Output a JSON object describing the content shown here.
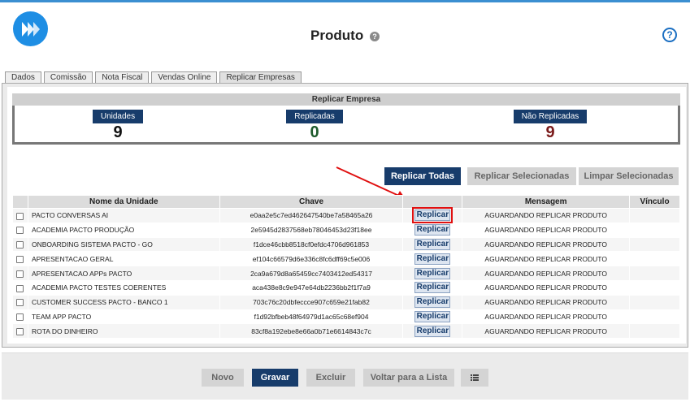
{
  "header": {
    "title": "Produto",
    "help_glyph": "?",
    "title_help_glyph": "?"
  },
  "tabs": [
    {
      "label": "Dados"
    },
    {
      "label": "Comissão"
    },
    {
      "label": "Nota Fiscal"
    },
    {
      "label": "Vendas Online"
    },
    {
      "label": "Replicar Empresas"
    }
  ],
  "replicar": {
    "section_title": "Replicar Empresa",
    "stats": [
      {
        "label": "Unidades",
        "value": "9",
        "color": "#111111"
      },
      {
        "label": "Replicadas",
        "value": "0",
        "color": "#1e5b2c"
      },
      {
        "label": "Não Replicadas",
        "value": "9",
        "color": "#7a1a1a"
      }
    ],
    "actions": {
      "replicar_todas": "Replicar Todas",
      "replicar_selecionadas": "Replicar Selecionadas",
      "limpar_selecionadas": "Limpar Selecionadas"
    },
    "table": {
      "headers": [
        "",
        "Nome da Unidade",
        "Chave",
        "",
        "Mensagem",
        "Vínculo"
      ],
      "rows": [
        {
          "nome": "PACTO CONVERSAS AI",
          "chave": "e0aa2e5c7ed462647540be7a58465a26",
          "acao": "Replicar",
          "mensagem": "AGUARDANDO REPLICAR PRODUTO",
          "vinculo": ""
        },
        {
          "nome": "ACADEMIA PACTO PRODUÇÃO",
          "chave": "2e5945d2837568eb78046453d23f18ee",
          "acao": "Replicar",
          "mensagem": "AGUARDANDO REPLICAR PRODUTO",
          "vinculo": ""
        },
        {
          "nome": "ONBOARDING SISTEMA PACTO - GO",
          "chave": "f1dce46cbb8518cf0efdc4706d961853",
          "acao": "Replicar",
          "mensagem": "AGUARDANDO REPLICAR PRODUTO",
          "vinculo": ""
        },
        {
          "nome": "APRESENTACAO GERAL",
          "chave": "ef104c66579d6e336c8fc6dff69c5e006",
          "acao": "Replicar",
          "mensagem": "AGUARDANDO REPLICAR PRODUTO",
          "vinculo": ""
        },
        {
          "nome": "APRESENTACAO APPs PACTO",
          "chave": "2ca9a679d8a65459cc7403412ed54317",
          "acao": "Replicar",
          "mensagem": "AGUARDANDO REPLICAR PRODUTO",
          "vinculo": ""
        },
        {
          "nome": "ACADEMIA PACTO TESTES COERENTES",
          "chave": "aca438e8c9e947e64db2236bb2f1f7a9",
          "acao": "Replicar",
          "mensagem": "AGUARDANDO REPLICAR PRODUTO",
          "vinculo": ""
        },
        {
          "nome": "CUSTOMER SUCCESS PACTO - BANCO 1",
          "chave": "703c76c20dbfeccce907c659e21fab82",
          "acao": "Replicar",
          "mensagem": "AGUARDANDO REPLICAR PRODUTO",
          "vinculo": ""
        },
        {
          "nome": "TEAM APP PACTO",
          "chave": "f1d92bfbeb48f64979d1ac65c68ef904",
          "acao": "Replicar",
          "mensagem": "AGUARDANDO REPLICAR PRODUTO",
          "vinculo": ""
        },
        {
          "nome": "ROTA DO DINHEIRO",
          "chave": "83cf8a192ebe8e66a0b71e6614843c7c",
          "acao": "Replicar",
          "mensagem": "AGUARDANDO REPLICAR PRODUTO",
          "vinculo": ""
        }
      ]
    }
  },
  "footer": {
    "novo": "Novo",
    "gravar": "Gravar",
    "excluir": "Excluir",
    "voltar": "Voltar para a Lista",
    "list_icon": "list-icon"
  },
  "colors": {
    "primary": "#173c6b",
    "accent_bar": "#3b8fd1",
    "highlight": "#e01010"
  }
}
